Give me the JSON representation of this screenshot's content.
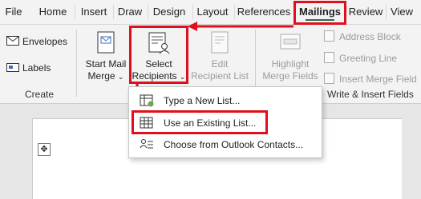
{
  "tabs": [
    {
      "label": "File"
    },
    {
      "label": "Home"
    },
    {
      "label": "Insert"
    },
    {
      "label": "Draw"
    },
    {
      "label": "Design"
    },
    {
      "label": "Layout"
    },
    {
      "label": "References"
    },
    {
      "label": "Mailings",
      "active": true
    },
    {
      "label": "Review"
    },
    {
      "label": "View"
    }
  ],
  "ribbon": {
    "create": {
      "envelopes": "Envelopes",
      "labels": "Labels",
      "group_label": "Create"
    },
    "start_mail_merge": {
      "line1": "Start Mail",
      "line2": "Merge"
    },
    "select_recipients": {
      "line1": "Select",
      "line2": "Recipients"
    },
    "edit_recipient_list": {
      "line1": "Edit",
      "line2": "Recipient List"
    },
    "highlight_merge_fields": {
      "line1": "Highlight",
      "line2": "Merge Fields"
    },
    "address_block": "Address Block",
    "greeting_line": "Greeting Line",
    "insert_merge_field": "Insert Merge Field",
    "write_insert_group_label": "Write & Insert Fields"
  },
  "dropdown": {
    "items": [
      {
        "label": "Type a New List...",
        "icon": "new-list-icon"
      },
      {
        "label": "Use an Existing List...",
        "icon": "existing-list-icon"
      },
      {
        "label": "Choose from Outlook Contacts...",
        "icon": "outlook-contacts-icon"
      }
    ]
  },
  "colors": {
    "highlight": "#e10e1d",
    "accent": "#217346",
    "ribbon_bg": "#f3f3f3"
  }
}
